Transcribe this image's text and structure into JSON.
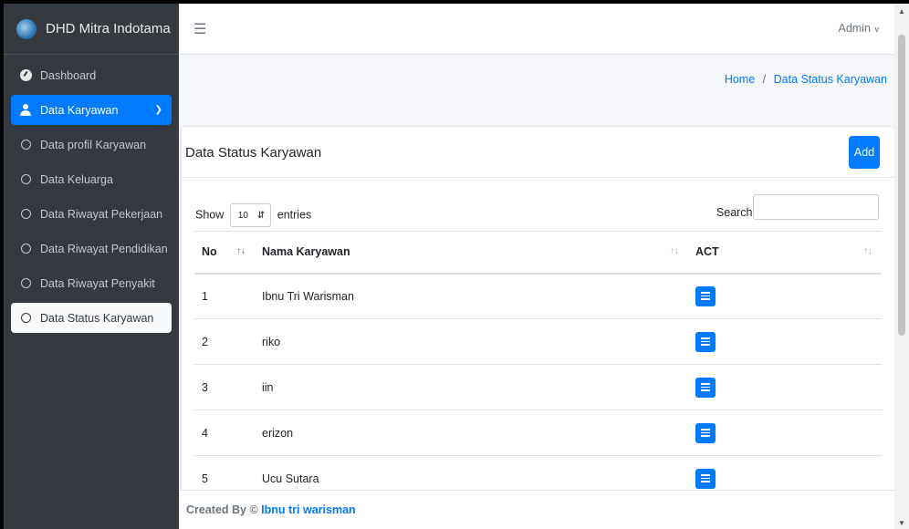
{
  "brand": {
    "name": "DHD Mitra Indotama"
  },
  "sidebar": {
    "items": [
      {
        "label": "Dashboard",
        "icon": "dashboard-icon"
      },
      {
        "label": "Data Karyawan",
        "icon": "user-icon"
      },
      {
        "label": "Data profil Karyawan",
        "icon": "circle-icon"
      },
      {
        "label": "Data Keluarga",
        "icon": "circle-icon"
      },
      {
        "label": "Data Riwayat Pekerjaan",
        "icon": "circle-icon"
      },
      {
        "label": "Data Riwayat Pendidikan",
        "icon": "circle-icon"
      },
      {
        "label": "Data Riwayat Penyakit",
        "icon": "circle-icon"
      },
      {
        "label": "Data Status Karyawan",
        "icon": "circle-icon"
      }
    ]
  },
  "topbar": {
    "user": "Admin"
  },
  "breadcrumb": {
    "home": "Home",
    "separator": "/",
    "current": "Data Status Karyawan"
  },
  "card": {
    "title": "Data Status Karyawan",
    "add_label": "Add",
    "show_label": "Show",
    "entries_value": "10",
    "entries_label": "entries",
    "search_label": "Search:",
    "search_value": ""
  },
  "table": {
    "columns": [
      "No",
      "Nama Karyawan",
      "ACT"
    ],
    "rows": [
      {
        "no": "1",
        "name": "Ibnu Tri Warisman"
      },
      {
        "no": "2",
        "name": "riko"
      },
      {
        "no": "3",
        "name": "iin"
      },
      {
        "no": "4",
        "name": "erizon"
      },
      {
        "no": "5",
        "name": "Ucu Sutara"
      }
    ]
  },
  "footer": {
    "prefix": "Created By ©",
    "author": "Ibnu tri warisman"
  },
  "colors": {
    "primary": "#007bff",
    "sidebar": "#343a40",
    "background": "#f4f6f9"
  }
}
